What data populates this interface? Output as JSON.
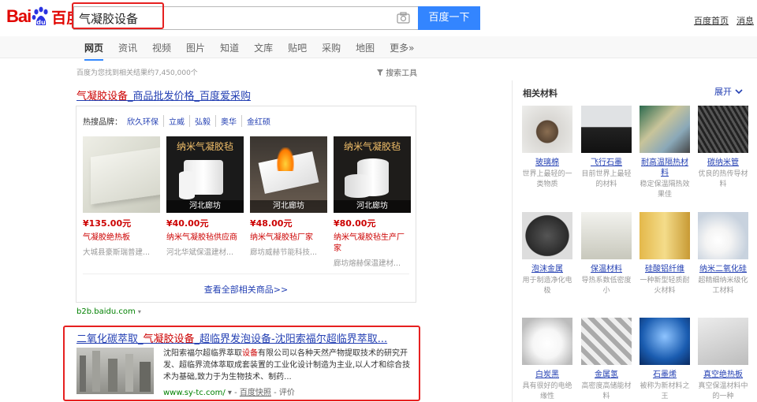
{
  "logo": {
    "bai": "Bai",
    "du": "百度"
  },
  "search": {
    "query": "气凝胶设备",
    "button": "百度一下"
  },
  "top_links": [
    "百度首页",
    "消息"
  ],
  "tabs": [
    "网页",
    "资讯",
    "视频",
    "图片",
    "知道",
    "文库",
    "贴吧",
    "采购",
    "地图",
    "更多»"
  ],
  "stats": "百度为您找到相关结果约7,450,000个",
  "search_tool": "搜索工具",
  "result1": {
    "title_pre": "气凝胶设备",
    "title_post": "_商品批发价格_百度爱采购",
    "hot_label": "热搜品牌：",
    "brands": [
      "欣久环保",
      "立威",
      "弘毅",
      "奥华",
      "金红硕"
    ],
    "products": [
      {
        "price": "¥135.00元",
        "name": "气凝胶绝热板",
        "seller": "大城县豪斯瑞普建...",
        "loc": "",
        "banner": ""
      },
      {
        "price": "¥40.00元",
        "name": "纳米气凝胶毡供应商",
        "seller": "河北华斌保温建材...",
        "loc": "河北廊坊",
        "banner": "纳米气凝胶毡"
      },
      {
        "price": "¥48.00元",
        "name": "纳米气凝胶毡厂家",
        "seller": "廊坊威赫节能科技...",
        "loc": "河北廊坊",
        "banner": ""
      },
      {
        "price": "¥80.00元",
        "name": "纳米气凝胶毡生产厂家",
        "seller": "廊坊熔赫保温建材...",
        "loc": "河北廊坊",
        "banner": "纳米气凝胶毡"
      }
    ],
    "view_all": "查看全部相关商品>>",
    "url": "b2b.baidu.com"
  },
  "result2": {
    "title_a": "二氧化碳萃取_",
    "title_em": "气凝胶设备",
    "title_b": "_超临界发泡设备-沈阳索福尔超临界萃取...",
    "desc_a": "沈阳索福尔超临界萃取",
    "desc_em": "设备",
    "desc_b": "有限公司以各种天然产物提取技术的研究开发、超临界流体萃取成套装置的工业化设计制造为主业,以人才和综合技术为基础,致力于为生物技术、制药...",
    "url": "www.sy-tc.com/",
    "snapshot": "百度快照",
    "review": "评价"
  },
  "panel": {
    "title": "相关材料",
    "expand": "展开",
    "materials": [
      {
        "name": "玻璃棉",
        "desc": "世界上最轻的一类物质"
      },
      {
        "name": "飞行石墨",
        "desc": "目前世界上最轻的材料"
      },
      {
        "name": "耐高温隔热材料",
        "desc": "稳定保温隔热效果佳"
      },
      {
        "name": "碳纳米管",
        "desc": "优良的热传导材料"
      },
      {
        "name": "泡沫金属",
        "desc": "用于制造净化电极"
      },
      {
        "name": "保温材料",
        "desc": "导热系数低密度小"
      },
      {
        "name": "硅酸铝纤维",
        "desc": "一种新型轻质耐火材料"
      },
      {
        "name": "纳米二氧化硅",
        "desc": "超精细纳米级化工材料"
      },
      {
        "name": "白炭黑",
        "desc": "具有很好的电绝缘性"
      },
      {
        "name": "金属氢",
        "desc": "高密度高储能材料"
      },
      {
        "name": "石墨烯",
        "desc": "被称为新材料之王"
      },
      {
        "name": "真空绝热板",
        "desc": "真空保温材料中的一种"
      }
    ]
  },
  "colors": {
    "brand_red": "#e10601",
    "button_blue": "#3385ff",
    "link_blue": "#2440b3",
    "url_green": "#008000",
    "highlight_red": "#c00",
    "annotation_red": "#e62020"
  }
}
